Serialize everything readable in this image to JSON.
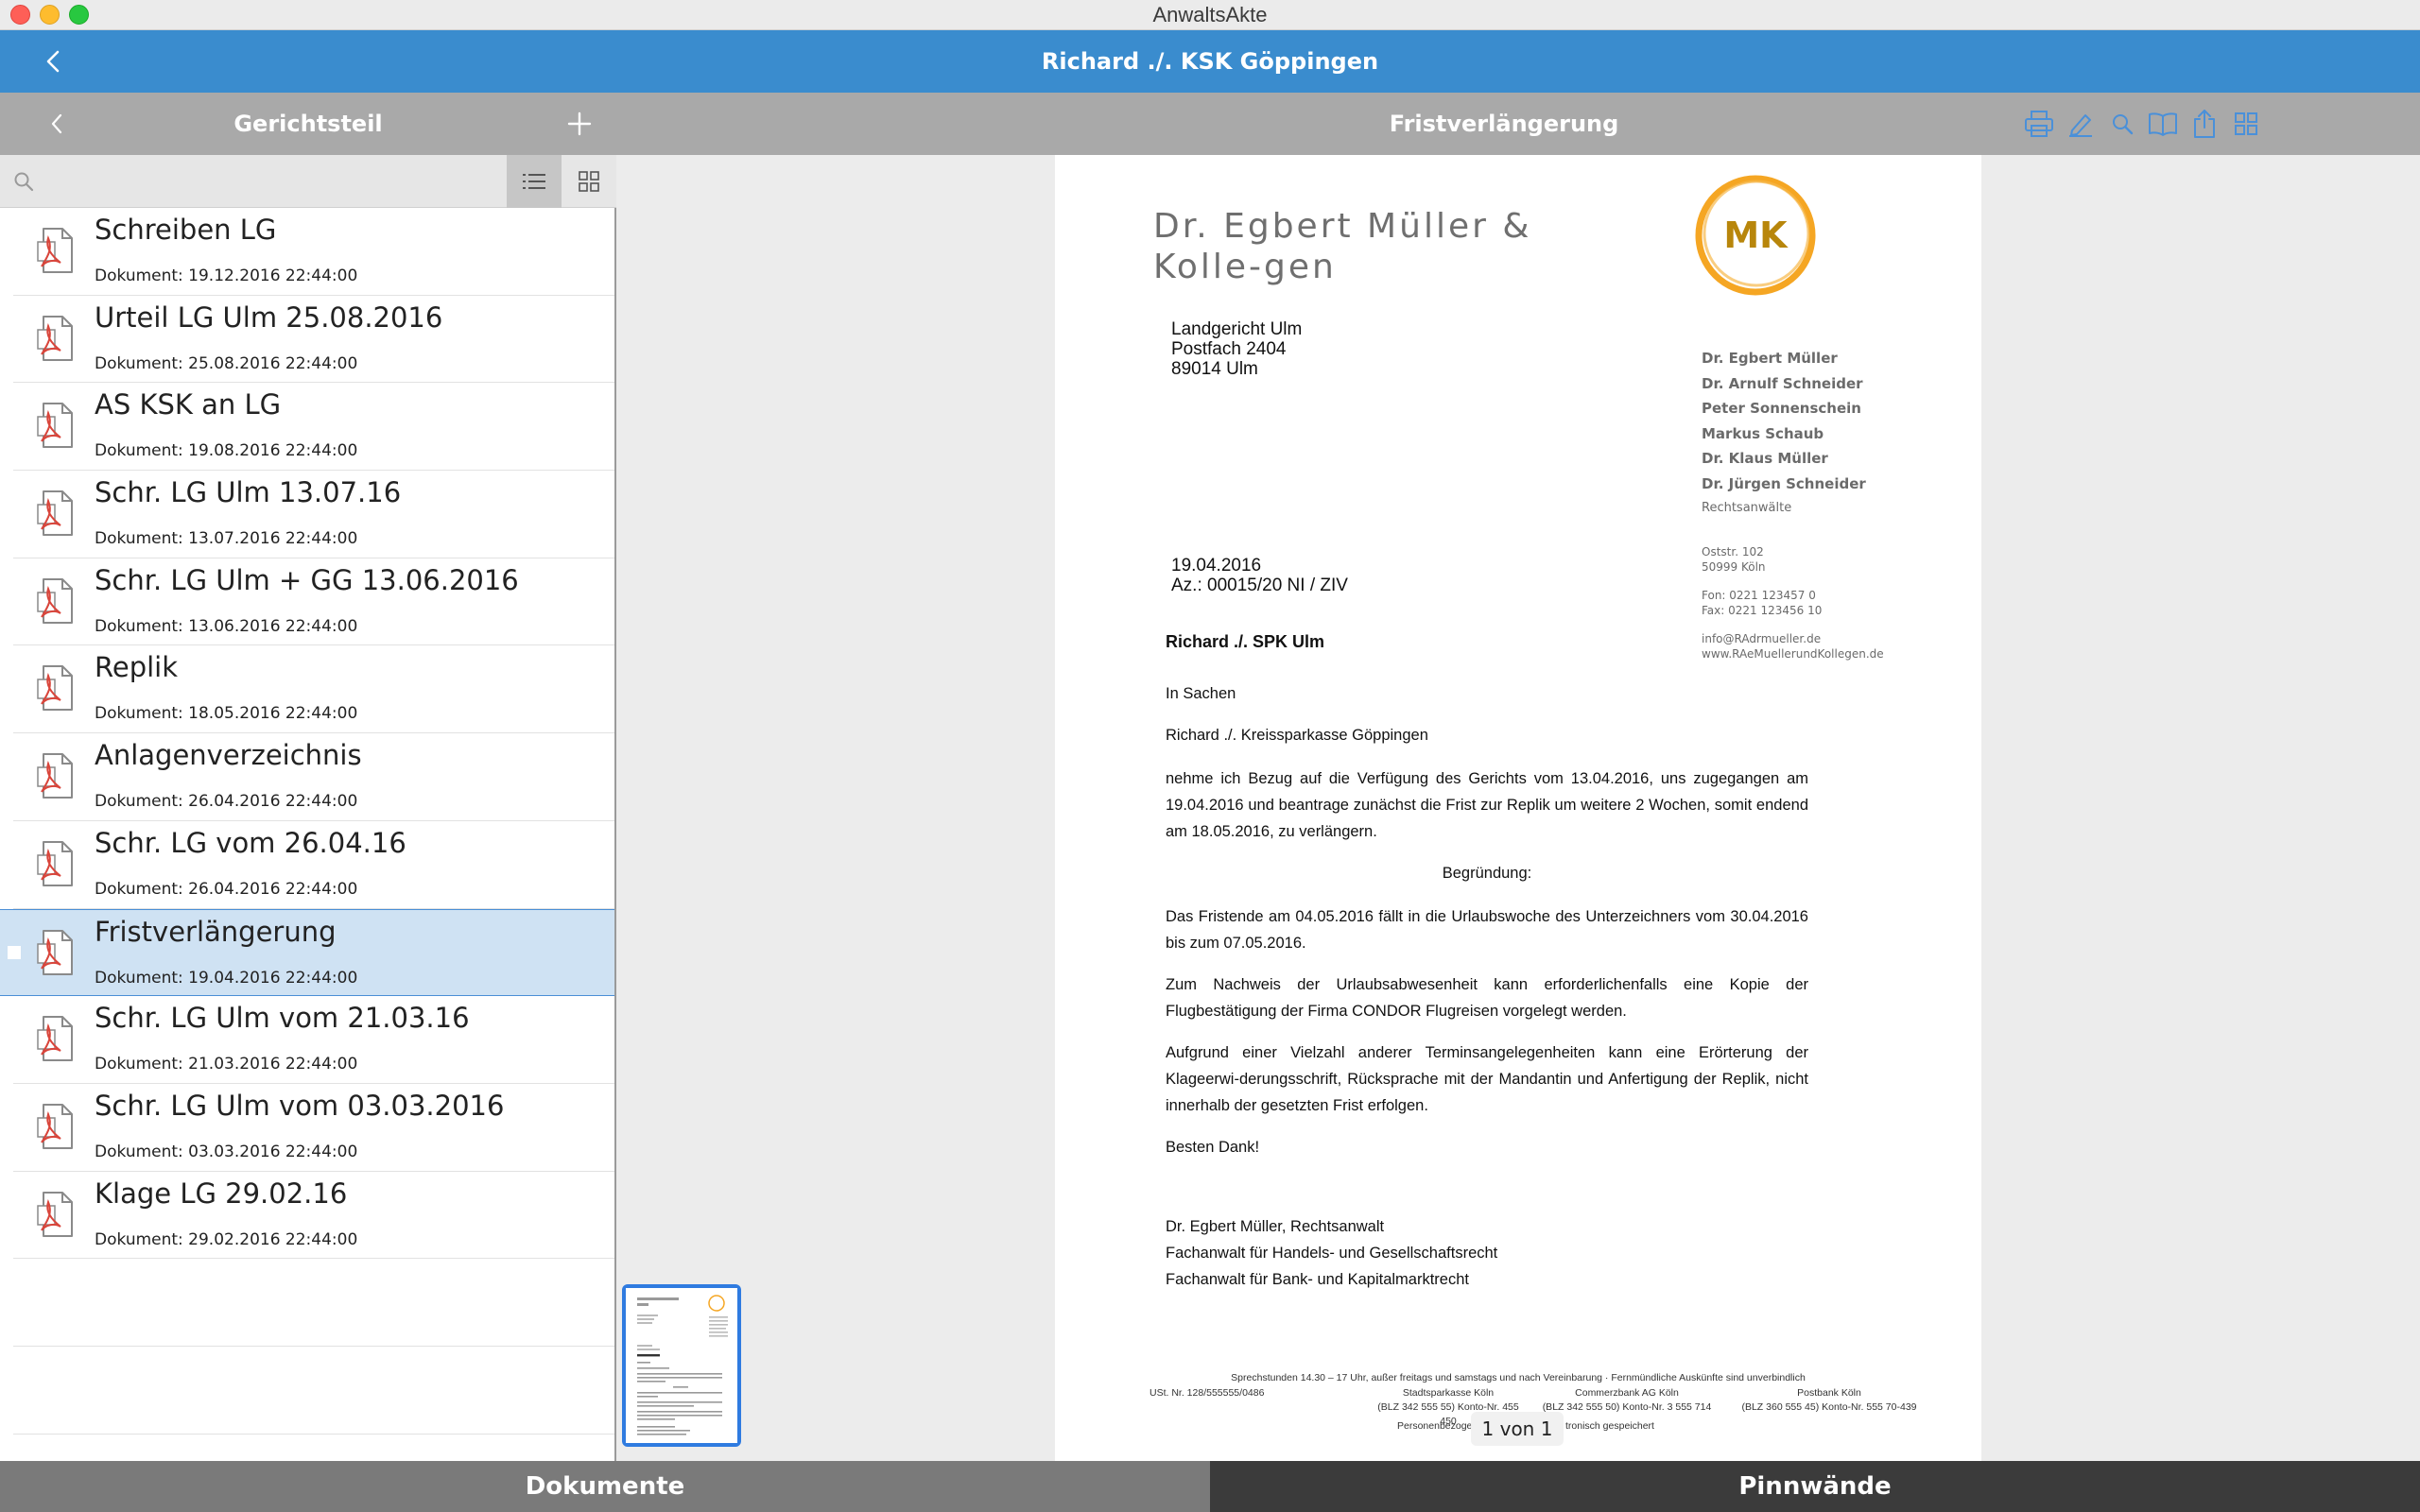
{
  "window": {
    "title": "AnwaltsAkte"
  },
  "header": {
    "title": "Richard ./. KSK Göppingen"
  },
  "sidebar": {
    "title": "Gerichtsteil",
    "search": {
      "placeholder": ""
    },
    "documents": [
      {
        "name": "Schreiben LG",
        "meta": "Dokument: 19.12.2016 22:44:00"
      },
      {
        "name": "Urteil LG Ulm 25.08.2016",
        "meta": "Dokument: 25.08.2016 22:44:00"
      },
      {
        "name": "AS KSK an LG",
        "meta": "Dokument: 19.08.2016 22:44:00"
      },
      {
        "name": "Schr. LG Ulm 13.07.16",
        "meta": "Dokument: 13.07.2016 22:44:00"
      },
      {
        "name": "Schr. LG Ulm + GG 13.06.2016",
        "meta": "Dokument: 13.06.2016 22:44:00"
      },
      {
        "name": "Replik",
        "meta": "Dokument: 18.05.2016 22:44:00"
      },
      {
        "name": "Anlagenverzeichnis",
        "meta": "Dokument: 26.04.2016 22:44:00"
      },
      {
        "name": "Schr. LG vom 26.04.16",
        "meta": "Dokument: 26.04.2016 22:44:00"
      },
      {
        "name": "Fristverlängerung",
        "meta": "Dokument: 19.04.2016 22:44:00"
      },
      {
        "name": "Schr. LG Ulm vom 21.03.16",
        "meta": "Dokument: 21.03.2016 22:44:00"
      },
      {
        "name": "Schr. LG Ulm vom 03.03.2016",
        "meta": "Dokument: 03.03.2016 22:44:00"
      },
      {
        "name": "Klage LG 29.02.16",
        "meta": "Dokument: 29.02.2016 22:44:00"
      }
    ],
    "selected_index": 8
  },
  "viewer": {
    "title": "Fristverlängerung",
    "page_indicator": "1 von 1",
    "letter": {
      "firm_name": "Dr. Egbert Müller & Kolle-gen",
      "logo_text": "MK",
      "recipient": [
        "Landgericht Ulm",
        "Postfach 2404",
        "89014 Ulm"
      ],
      "partners": [
        "Dr. Egbert Müller",
        "Dr. Arnulf Schneider",
        "Peter Sonnenschein",
        "Markus Schaub",
        "Dr. Klaus Müller",
        "Dr. Jürgen Schneider"
      ],
      "partners_role": "Rechtsanwälte",
      "address": [
        "Oststr. 102",
        "50999 Köln"
      ],
      "phone": "Fon:  0221  123457 0",
      "fax": "Fax:   0221  123456 10",
      "email": "info@RAdrmueller.de",
      "web": "www.RAeMuellerundKollegen.de",
      "date": "19.04.2016",
      "reference": "Az.: 00015/20 NI / ZIV",
      "subject": "Richard ./. SPK Ulm",
      "in_sachen": "In Sachen",
      "case_line": "Richard ./. Kreissparkasse Göppingen",
      "para1": "nehme ich Bezug auf die Verfügung des Gerichts vom 13.04.2016, uns zugegangen am 19.04.2016 und beantrage zunächst die Frist zur Replik um weitere 2 Wochen, somit endend am 18.05.2016, zu verlängern.",
      "heading": "Begründung:",
      "para2": "Das Fristende am 04.05.2016 fällt in die Urlaubswoche des Unterzeichners vom 30.04.2016 bis zum 07.05.2016.",
      "para3": "Zum Nachweis der Urlaubsabwesenheit kann erforderlichenfalls eine Kopie der Flugbestätigung der Firma CONDOR Flugreisen vorgelegt werden.",
      "para4": "Aufgrund einer Vielzahl anderer Terminsangelegenheiten kann eine Erörterung der Klageerwi-derungsschrift, Rücksprache mit der Mandantin und Anfertigung der Replik, nicht innerhalb der gesetzten Frist erfolgen.",
      "closing": "Besten Dank!",
      "signature": [
        "Dr. Egbert Müller, Rechtsanwalt",
        "Fachanwalt für Handels- und Gesellschaftsrecht",
        "Fachanwalt für Bank- und Kapitalmarktrecht"
      ],
      "footer_hours": "Sprechstunden 14.30 – 17 Uhr, außer freitags und samstags und nach Vereinbarung · Fernmündliche Auskünfte sind unverbindlich",
      "footer_vat": "USt. Nr. 128/555555/0486",
      "banks": [
        {
          "name": "Stadtsparkasse Köln",
          "details": "(BLZ 342 555 55) Konto-Nr. 455 450"
        },
        {
          "name": "Commerzbank AG Köln",
          "details": "(BLZ 342 555 50) Konto-Nr. 3 555 714"
        },
        {
          "name": "Postbank Köln",
          "details": "(BLZ 360 555 45) Konto-Nr. 555 70-439"
        }
      ],
      "footer_partial_left": "Personenbezoge",
      "footer_partial_right": "tronisch gespeichert"
    }
  },
  "tabs": {
    "documents": "Dokumente",
    "pinboards": "Pinnwände"
  },
  "colors": {
    "header_blue": "#3a8cce",
    "toolbar_gray": "#a9a9a9",
    "selection": "#cfe2f3",
    "accent_icon": "#4a90d9",
    "logo_orange": "#f5a623",
    "logo_text": "#b8860b",
    "pdf_red": "#d9453b"
  }
}
